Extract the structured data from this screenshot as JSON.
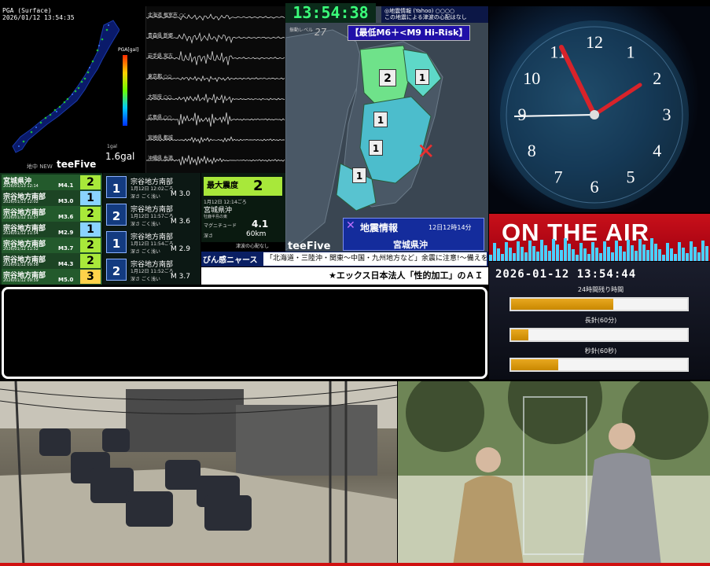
{
  "pga": {
    "header_title": "PGA (Surface)",
    "header_time": "2026/01/12 13:54:35",
    "scale_label": "PGA[gal]",
    "gal_small": "1gal",
    "gal_value": "1.6gal",
    "jika_new": "地中 NEW",
    "brand": "teeFive"
  },
  "waveform": {
    "stations": [
      "北海道 根室市 ○○",
      "青森県 新郷",
      "岩手県 宮古",
      "東京都 ○○",
      "大阪府 ○○",
      "広島県 ○○",
      "宮崎県 都城",
      "沖縄県 糸満"
    ]
  },
  "clock_digits": "13:54:38",
  "notice": {
    "line1": "◎地震情報 (Yahoo) ○○○○",
    "line2": "この地震による津波の心配はなし"
  },
  "map": {
    "level_label": "振動レベル",
    "level_value": "27",
    "risk": "【最低M6＋<M9 Hi-Risk】",
    "intensities": [
      "2",
      "1",
      "1",
      "1",
      "1"
    ],
    "info_title": "地震情報",
    "info_time": "12日12時14分",
    "info_place": "宮城県沖",
    "brand": "teeFive"
  },
  "space_clock": {
    "numbers": [
      "12",
      "1",
      "2",
      "3",
      "4",
      "5",
      "6",
      "7",
      "8",
      "9",
      "10",
      "11"
    ]
  },
  "on_air": "ON THE AIR",
  "countdown": {
    "datetime": "2026-01-12 13:54:44",
    "bars": [
      {
        "label": "24時間残り時間",
        "progress": 0.58
      },
      {
        "label": "長針(60分)",
        "progress": 0.1
      },
      {
        "label": "秒針(60秒)",
        "progress": 0.27
      }
    ]
  },
  "quake_list": [
    {
      "name": "宮城県沖",
      "time": "2026/01/13 12:14",
      "mag": "M4.1",
      "scale": "2",
      "color": "#a8e83a"
    },
    {
      "name": "宗谷地方南部",
      "time": "2026/01/13 12:02",
      "mag": "M3.0",
      "scale": "1",
      "color": "#8ad3ff"
    },
    {
      "name": "宗谷地方南部",
      "time": "2026/01/12 11:57",
      "mag": "M3.6",
      "scale": "2",
      "color": "#a8e83a"
    },
    {
      "name": "宗谷地方南部",
      "time": "2026/01/12 11:54",
      "mag": "M2.9",
      "scale": "1",
      "color": "#8ad3ff"
    },
    {
      "name": "宗谷地方南部",
      "time": "2026/01/12 11:52",
      "mag": "M3.7",
      "scale": "2",
      "color": "#a8e83a"
    },
    {
      "name": "宗谷地方南部",
      "time": "2026/01/12 09:58",
      "mag": "M4.3",
      "scale": "2",
      "color": "#a8e83a"
    },
    {
      "name": "宗谷地方南部",
      "time": "2026/01/12 09:59",
      "mag": "M5.0",
      "scale": "3",
      "color": "#ffd24a"
    }
  ],
  "events": [
    {
      "scale": "1",
      "place": "宗谷地方南部",
      "when": "1月12日 12:02ごろ",
      "depth": "深さ ごく浅い",
      "mag": "M 3.0"
    },
    {
      "scale": "2",
      "place": "宗谷地方南部",
      "when": "1月12日 11:57ごろ",
      "depth": "深さ ごく浅い",
      "mag": "M 3.6"
    },
    {
      "scale": "1",
      "place": "宗谷地方南部",
      "when": "1月12日 11:54ごろ",
      "depth": "深さ ごく浅い",
      "mag": "M 2.9"
    },
    {
      "scale": "2",
      "place": "宗谷地方南部",
      "when": "1月12日 11:52ごろ",
      "depth": "深さ ごく浅い",
      "mag": "M 3.7"
    }
  ],
  "max": {
    "label": "最大震度",
    "value": "2",
    "date": "1月12日 12:14ごろ",
    "place": "宮城県沖",
    "small": "牡鹿半島の東",
    "mag_label": "マグニチュード",
    "mag": "4.1",
    "depth_label": "深さ",
    "depth": "60km",
    "tsunami": "津波の心配なし"
  },
  "ticker1": {
    "label": "びん感ニャース",
    "text": "「北海道・三陸沖・関東〜中国・九州地方など」余震に注意!〜備えを〜"
  },
  "ticker2": "★エックス日本法人「性的加工」のＡＩ"
}
